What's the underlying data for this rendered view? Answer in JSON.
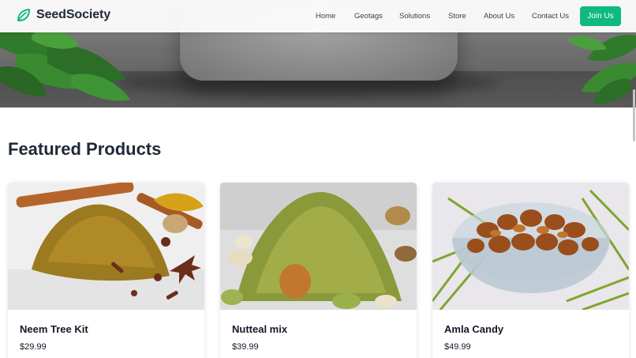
{
  "brand": {
    "name": "SeedSociety",
    "icon": "leaf-icon",
    "color": "#10b981"
  },
  "nav": {
    "links": [
      "Home",
      "Geotags",
      "Solutions",
      "Store",
      "About Us",
      "Contact Us"
    ],
    "cta": "Join Us"
  },
  "featured": {
    "title": "Featured Products",
    "products": [
      {
        "name": "Neem Tree Kit",
        "price": "$29.99",
        "image": "spice-powder-with-cinnamon-and-cloves"
      },
      {
        "name": "Nutteal mix",
        "price": "$39.99",
        "image": "green-powder-with-nuts"
      },
      {
        "name": "Amla Candy",
        "price": "$49.99",
        "image": "glass-bowl-of-dried-amla"
      }
    ]
  },
  "colors": {
    "accent": "#10b981",
    "text": "#1f2937"
  }
}
